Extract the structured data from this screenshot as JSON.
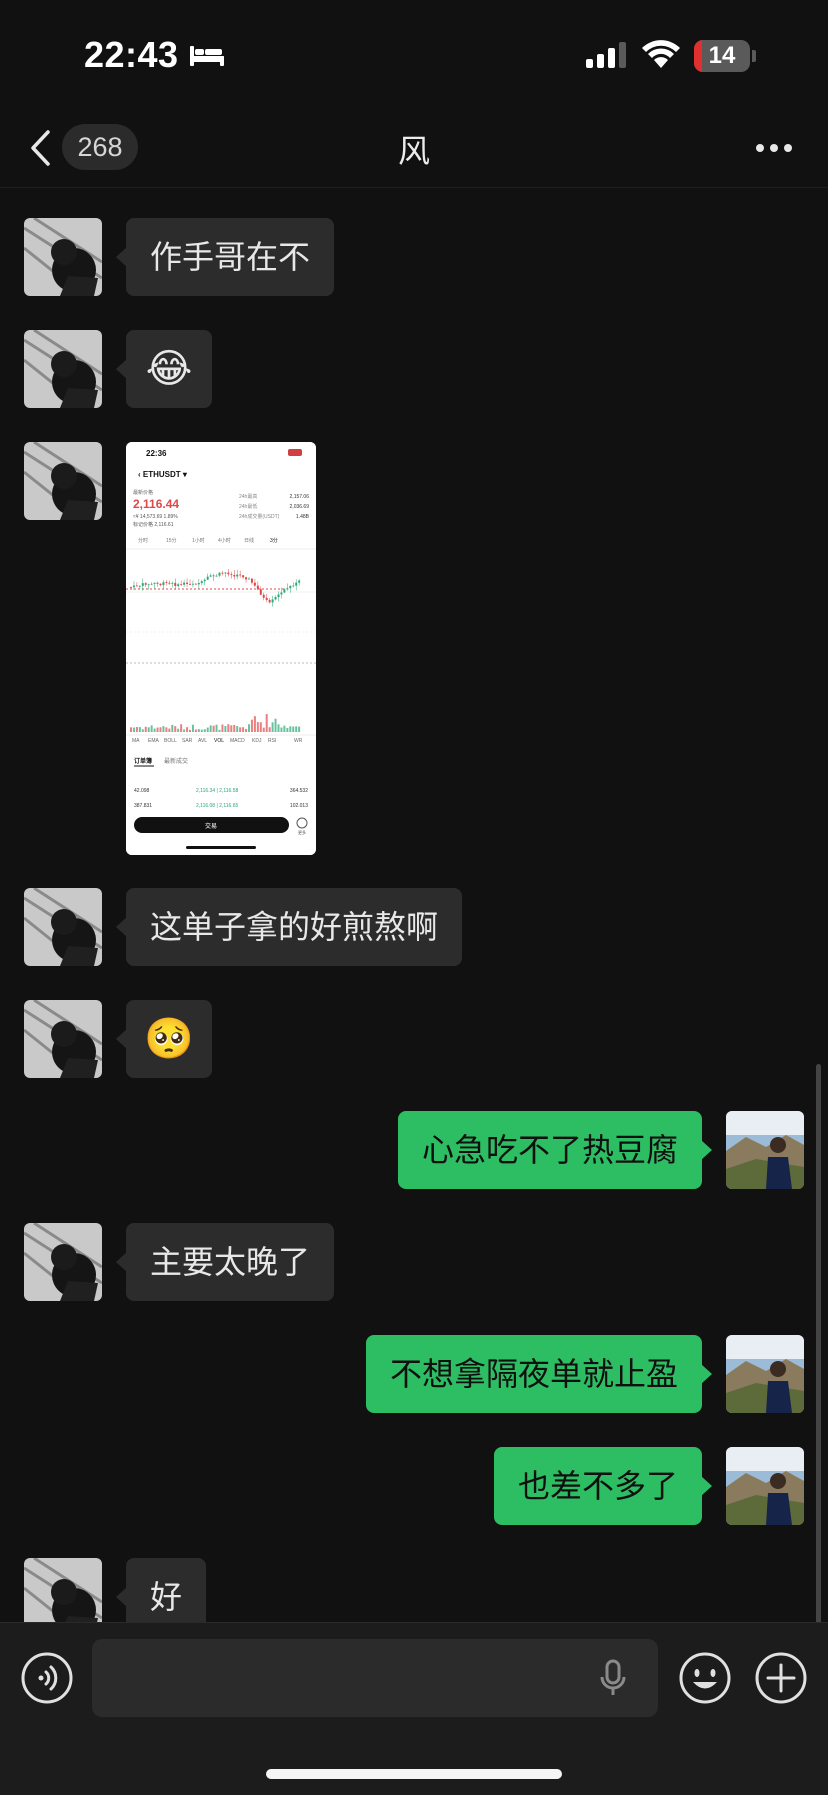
{
  "status_bar": {
    "time": "22:43",
    "battery": "14",
    "battery_level_pct": 14,
    "battery_color": "#e03030"
  },
  "nav": {
    "unread_count": "268",
    "title": "风"
  },
  "messages": {
    "m1": "作手哥在不",
    "m2": "😂",
    "m4": "这单子拿的好煎熬啊",
    "m5": "🥺",
    "m6": "心急吃不了热豆腐",
    "m7": "主要太晚了",
    "m8": "不想拿隔夜单就止盈",
    "m9": "也差不多了",
    "m10": "好"
  },
  "screenshot": {
    "time": "22:36",
    "symbol": "ETHUSDT",
    "last_price_label": "最新价格",
    "price": "2,116.44",
    "sub_line": "≈¥ 14,573.69  1.89%",
    "mark_line": "标记价格 2,116.61",
    "stats": [
      {
        "label": "24h最高",
        "value": "2,157.06"
      },
      {
        "label": "24h最低",
        "value": "2,036.69"
      },
      {
        "label": "24h成交量(USDT)",
        "value": "1.48B"
      }
    ],
    "intervals": [
      "分时",
      "15分",
      "1小时",
      "4小时",
      "日线",
      "3分"
    ],
    "indicators": [
      "MA",
      "EMA",
      "BOLL",
      "SAR",
      "AVL",
      "VOL",
      "MACD",
      "KDJ",
      "RSI",
      "WR"
    ],
    "book_tabs": [
      "订单簿",
      "最新成交"
    ],
    "book_rows": [
      {
        "left": "42.098",
        "mid": "2,116.34 | 2,116.58",
        "right": "364.532"
      },
      {
        "left": "387.831",
        "mid": "2,116.08 | 2,116.65",
        "right": "102.013"
      }
    ],
    "trade_button": "交易",
    "more_label": "更多",
    "up_color": "#2aa876",
    "down_color": "#e04848"
  },
  "input": {
    "placeholder": ""
  },
  "colors": {
    "outgoing_bubble": "#2dbd62",
    "incoming_bubble": "#2c2c2c",
    "background": "#111111"
  }
}
